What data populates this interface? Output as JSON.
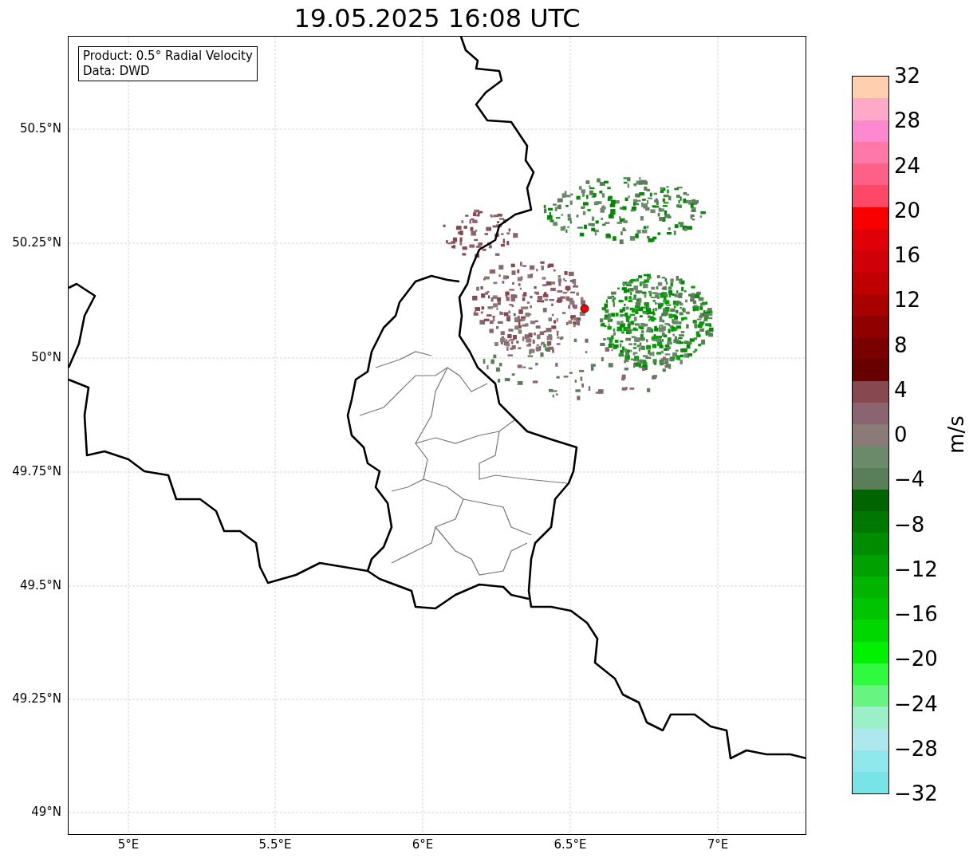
{
  "title": "19.05.2025 16:08 UTC",
  "legend_box": {
    "lines": [
      "Product: 0.5° Radial Velocity",
      "Data: DWD"
    ]
  },
  "map": {
    "y_tick_labels": [
      "50.5°N",
      "50.25°N",
      "50°N",
      "49.75°N",
      "49.5°N",
      "49.25°N",
      "49°N"
    ],
    "x_tick_labels": [
      "5°E",
      "5.5°E",
      "6°E",
      "6.5°E",
      "7°E"
    ]
  },
  "colorbar": {
    "label": "m/s",
    "tick_labels": [
      "32",
      "28",
      "24",
      "20",
      "16",
      "12",
      "8",
      "4",
      "0",
      "−4",
      "−8",
      "−12",
      "−16",
      "−20",
      "−24",
      "−28",
      "−32"
    ],
    "segments": [
      {
        "color": "#ffcfb0"
      },
      {
        "color": "#ffa8c8"
      },
      {
        "color": "#ff88d0"
      },
      {
        "color": "#ff78a8"
      },
      {
        "color": "#ff6088"
      },
      {
        "color": "#ff4866"
      },
      {
        "color": "#f80000"
      },
      {
        "color": "#e00008"
      },
      {
        "color": "#d00008"
      },
      {
        "color": "#c00000"
      },
      {
        "color": "#a80000"
      },
      {
        "color": "#900000"
      },
      {
        "color": "#7a0000"
      },
      {
        "color": "#680000"
      },
      {
        "color": "#884850"
      },
      {
        "color": "#8a6470"
      },
      {
        "color": "#8a7a78"
      },
      {
        "color": "#6a8a6a"
      },
      {
        "color": "#5a7e58"
      },
      {
        "color": "#006400"
      },
      {
        "color": "#007800"
      },
      {
        "color": "#008c00"
      },
      {
        "color": "#00a000"
      },
      {
        "color": "#00b400"
      },
      {
        "color": "#00c400"
      },
      {
        "color": "#00d600"
      },
      {
        "color": "#00f200"
      },
      {
        "color": "#30fa40"
      },
      {
        "color": "#68f480"
      },
      {
        "color": "#9cf0c8"
      },
      {
        "color": "#ace8ee"
      },
      {
        "color": "#8ee8ec"
      },
      {
        "color": "#78e4e8"
      }
    ]
  }
}
